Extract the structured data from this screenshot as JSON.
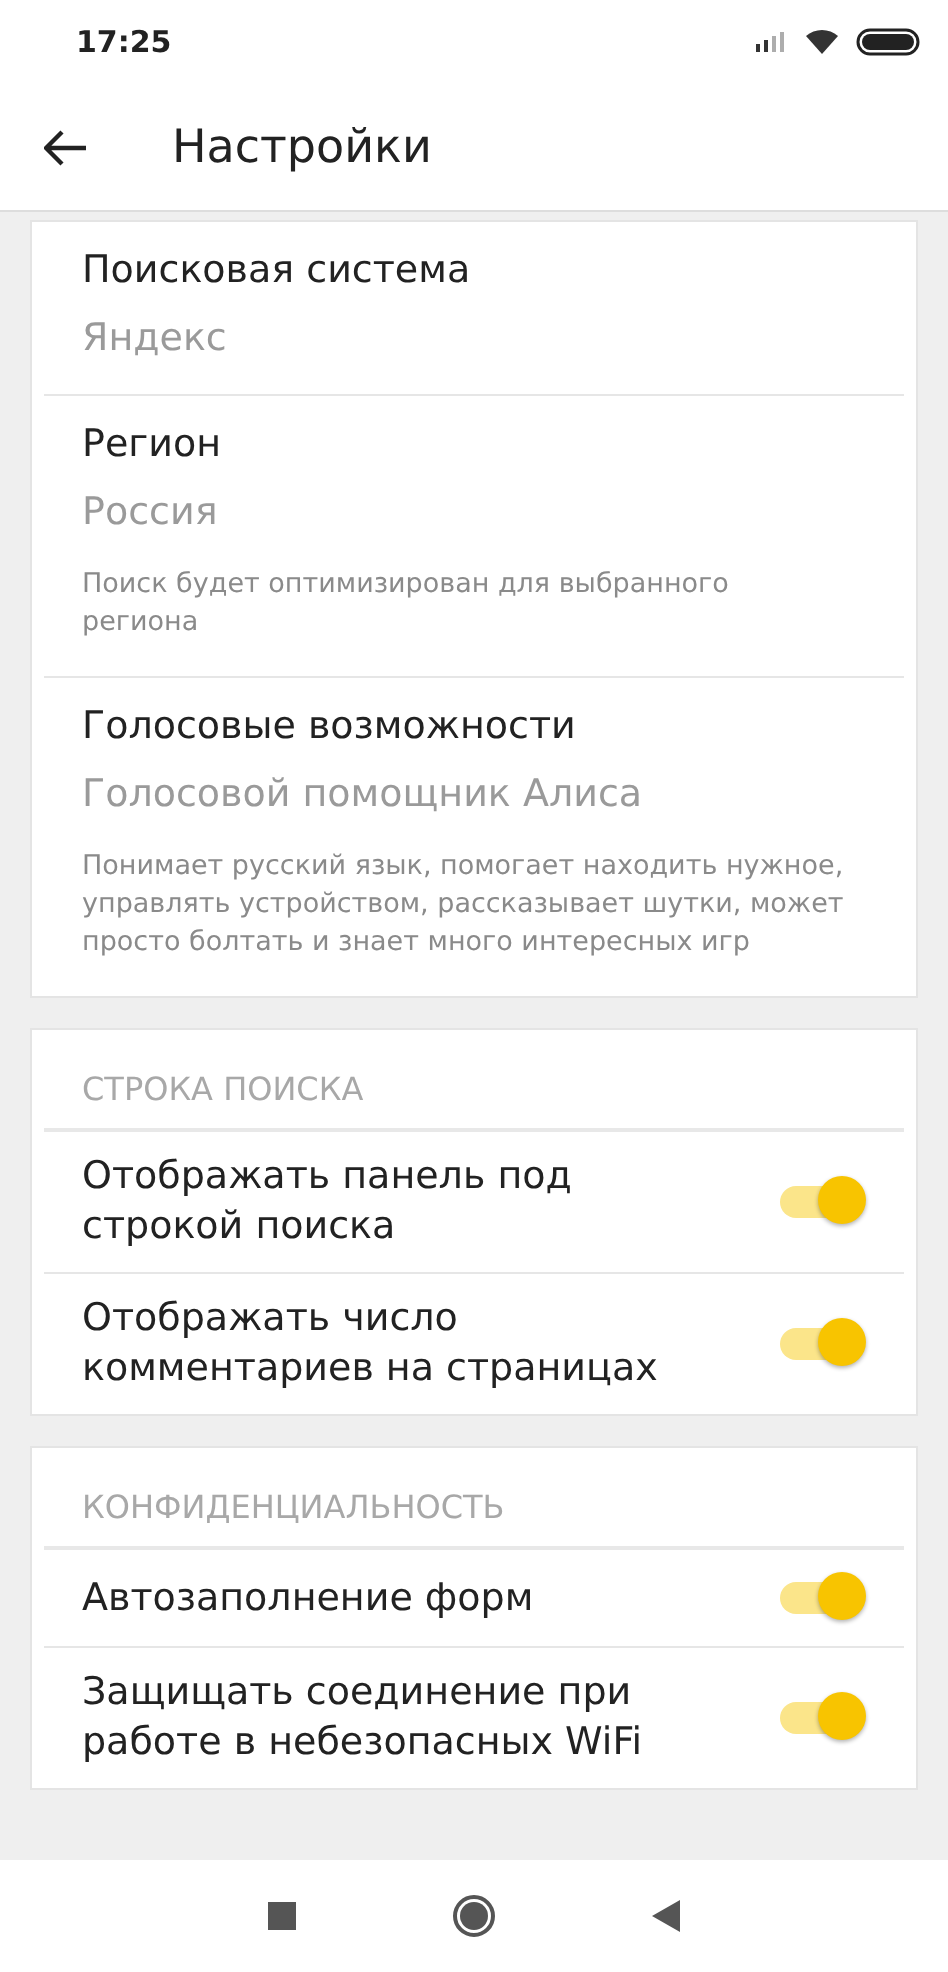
{
  "status_bar": {
    "time": "17:25"
  },
  "header": {
    "title": "Настройки"
  },
  "sections": [
    {
      "items": [
        {
          "kind": "choice",
          "title": "Поисковая система",
          "value": "Яндекс"
        },
        {
          "kind": "choice",
          "title": "Регион",
          "value": "Россия",
          "hint": "Поиск будет оптимизирован для выбранного региона"
        },
        {
          "kind": "choice",
          "title": "Голосовые возможности",
          "value": "Голосовой помощник Алиса",
          "hint": "Понимает русский язык, помогает находить нужное, управлять устройством, рассказывает шутки, может просто болтать и знает много интересных игр"
        }
      ]
    },
    {
      "heading": "СТРОКА ПОИСКА",
      "items": [
        {
          "kind": "toggle",
          "title": "Отображать панель под строкой поиска",
          "on": true
        },
        {
          "kind": "toggle",
          "title": "Отображать число комментариев на страницах",
          "on": true
        }
      ]
    },
    {
      "heading": "КОНФИДЕНЦИАЛЬНОСТЬ",
      "items": [
        {
          "kind": "toggle",
          "title": "Автозаполнение форм",
          "on": true
        },
        {
          "kind": "toggle",
          "title": "Защищать соединение при работе в небезопасных WiFi",
          "on": true
        }
      ]
    }
  ]
}
